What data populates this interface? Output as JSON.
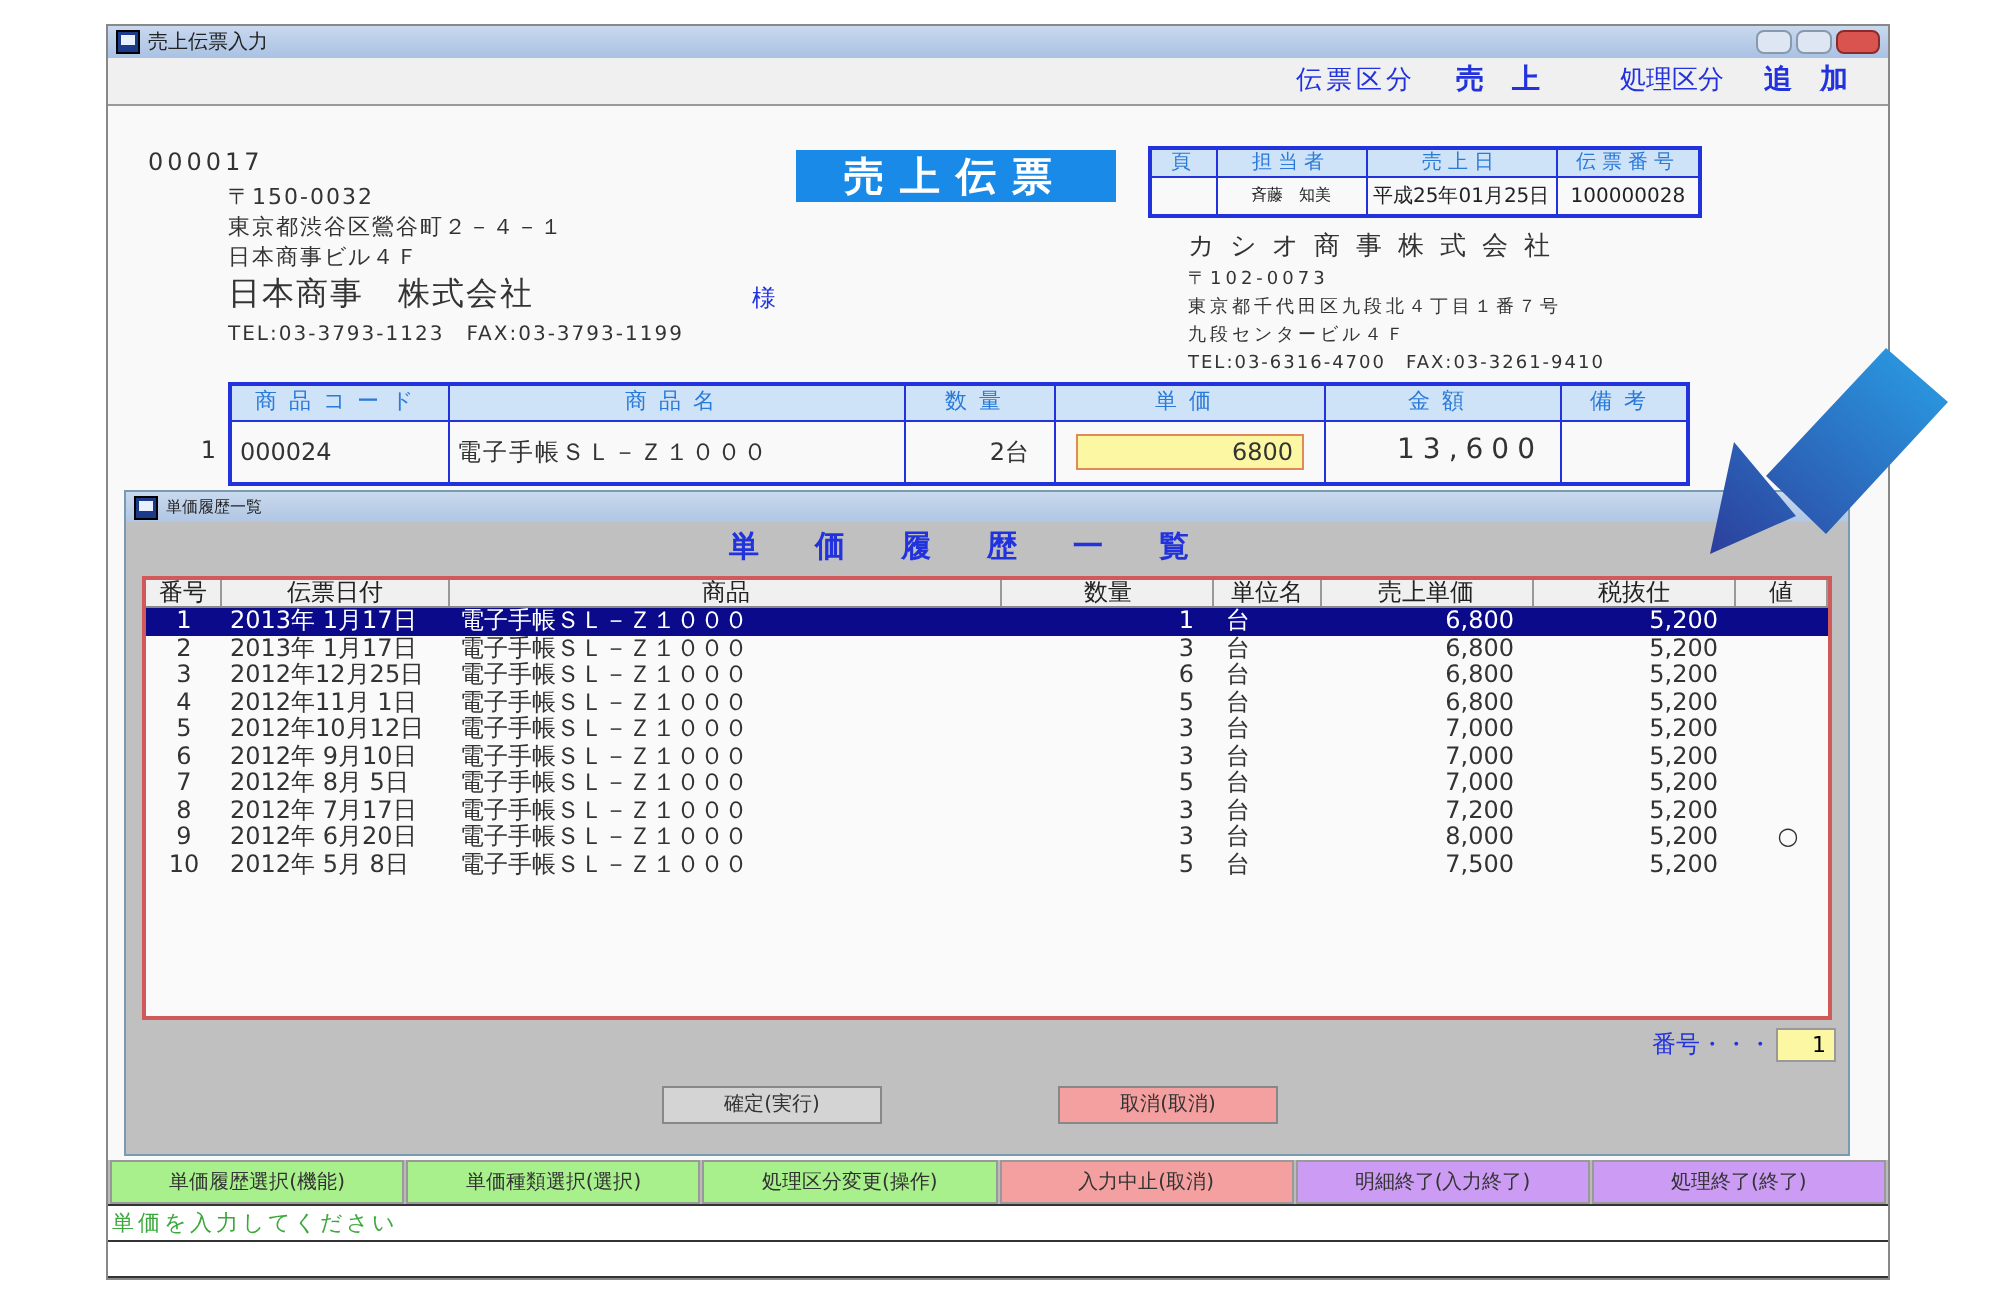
{
  "window": {
    "title": "売上伝票入力"
  },
  "header": {
    "slip_type_label": "伝票区分",
    "slip_type": "売　上",
    "process_label": "処理区分",
    "process": "追　加"
  },
  "slip": {
    "number": "000017",
    "title": "売上伝票",
    "customer": {
      "postal": "〒150-0032",
      "address1": "東京都渋谷区鶯谷町２－４－１",
      "address2": "日本商事ビル４Ｆ",
      "name": "日本商事　株式会社",
      "honorific": "様",
      "tel_fax": "TEL:03-3793-1123　FAX:03-3793-1199"
    },
    "info_table": {
      "columns": [
        "頁",
        "担当者",
        "売上日",
        "伝票番号"
      ],
      "staff": "斉藤　知美",
      "date": "平成25年01月25日",
      "slip_no": "100000028"
    },
    "company": {
      "name": "カシオ商事株式会社",
      "postal": "〒102-0073",
      "address1": "東京都千代田区九段北４丁目１番７号",
      "address2": "九段センタービル４Ｆ",
      "tel_fax": "TEL:03-6316-4700　FAX:03-3261-9410"
    },
    "lines_table": {
      "columns": [
        "商品コード",
        "商品名",
        "数量",
        "単価",
        "金額",
        "備考"
      ],
      "rows": [
        {
          "no": "1",
          "code": "000024",
          "name": "電子手帳ＳＬ－Ｚ１０００",
          "qty": "2台",
          "price": "6800",
          "amount": "13,600"
        }
      ]
    }
  },
  "dialog": {
    "title": "単価履歴一覧",
    "heading": "単価履歴一覧",
    "columns": [
      "番号",
      "伝票日付",
      "商品",
      "数量",
      "単位名",
      "売上単価",
      "税抜仕",
      "値"
    ],
    "rows": [
      {
        "no": "1",
        "date": "2013年 1月17日",
        "item": "電子手帳ＳＬ－Ｚ１０００",
        "qty": "1",
        "unit": "台",
        "price": "6,800",
        "cost": "5,200",
        "selected": true
      },
      {
        "no": "2",
        "date": "2013年 1月17日",
        "item": "電子手帳ＳＬ－Ｚ１０００",
        "qty": "3",
        "unit": "台",
        "price": "6,800",
        "cost": "5,200",
        "selected": false
      },
      {
        "no": "3",
        "date": "2012年12月25日",
        "item": "電子手帳ＳＬ－Ｚ１０００",
        "qty": "6",
        "unit": "台",
        "price": "6,800",
        "cost": "5,200",
        "selected": false
      },
      {
        "no": "4",
        "date": "2012年11月 1日",
        "item": "電子手帳ＳＬ－Ｚ１０００",
        "qty": "5",
        "unit": "台",
        "price": "6,800",
        "cost": "5,200",
        "selected": false
      },
      {
        "no": "5",
        "date": "2012年10月12日",
        "item": "電子手帳ＳＬ－Ｚ１０００",
        "qty": "3",
        "unit": "台",
        "price": "7,000",
        "cost": "5,200",
        "selected": false
      },
      {
        "no": "6",
        "date": "2012年 9月10日",
        "item": "電子手帳ＳＬ－Ｚ１０００",
        "qty": "3",
        "unit": "台",
        "price": "7,000",
        "cost": "5,200",
        "selected": false
      },
      {
        "no": "7",
        "date": "2012年 8月 5日",
        "item": "電子手帳ＳＬ－Ｚ１０００",
        "qty": "5",
        "unit": "台",
        "price": "7,000",
        "cost": "5,200",
        "selected": false
      },
      {
        "no": "8",
        "date": "2012年 7月17日",
        "item": "電子手帳ＳＬ－Ｚ１０００",
        "qty": "3",
        "unit": "台",
        "price": "7,200",
        "cost": "5,200",
        "selected": false
      },
      {
        "no": "9",
        "date": "2012年 6月20日",
        "item": "電子手帳ＳＬ－Ｚ１０００",
        "qty": "3",
        "unit": "台",
        "price": "8,000",
        "cost": "5,200",
        "mark": "○",
        "selected": false
      },
      {
        "no": "10",
        "date": "2012年 5月 8日",
        "item": "電子手帳ＳＬ－Ｚ１０００",
        "qty": "5",
        "unit": "台",
        "price": "7,500",
        "cost": "5,200",
        "selected": false
      }
    ],
    "number_label": "番号・・・",
    "number_value": "1",
    "buttons": [
      {
        "label": "確定(実行)",
        "color": "#d4d4d4"
      },
      {
        "label": "取消(取消)",
        "color": "#f4a0a0"
      }
    ]
  },
  "function_keys": [
    {
      "label": "単価履歴選択(機能)",
      "color": "#a8f08c"
    },
    {
      "label": "単価種類選択(選択)",
      "color": "#a8f08c"
    },
    {
      "label": "処理区分変更(操作)",
      "color": "#a8f08c"
    },
    {
      "label": "入力中止(取消)",
      "color": "#f4a0a0"
    },
    {
      "label": "明細終了(入力終了)",
      "color": "#cc9cf4"
    },
    {
      "label": "処理終了(終了)",
      "color": "#cc9cf4"
    }
  ],
  "status_message": "単価を入力してください"
}
